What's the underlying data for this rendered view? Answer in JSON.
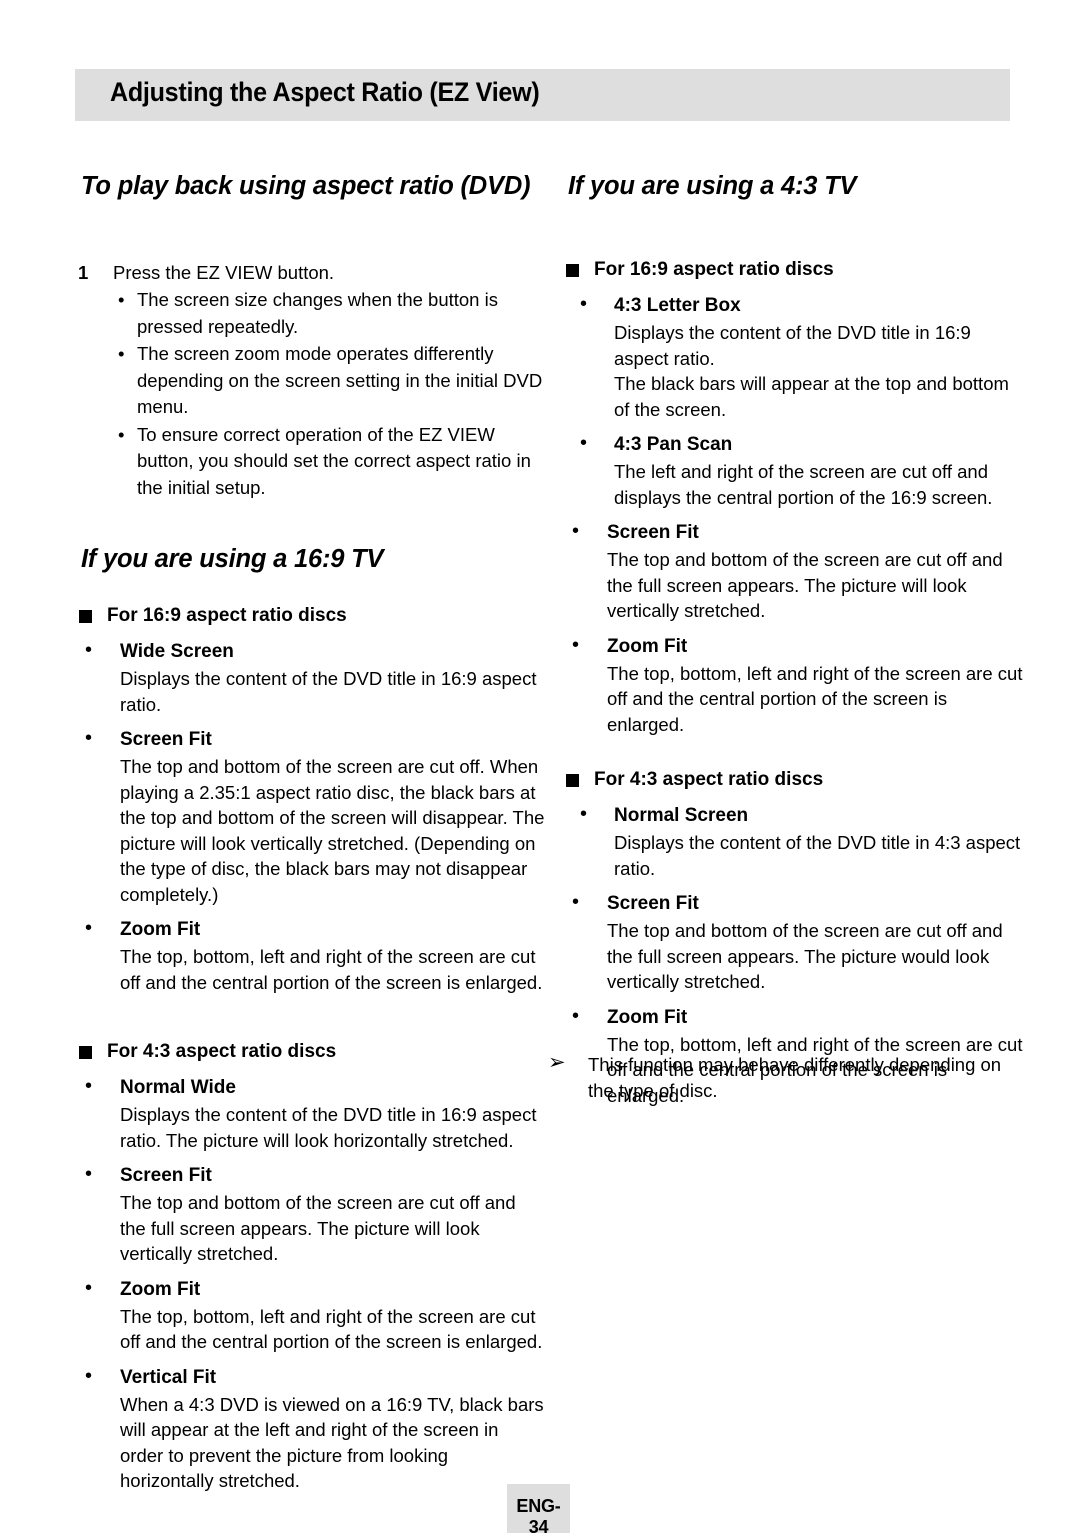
{
  "page": {
    "header_title": "Adjusting the Aspect Ratio (EZ View)",
    "footer_label": "ENG-34",
    "accent_gray": "#dedede"
  },
  "left_column": {
    "heading_1": "To play back using aspect ratio (DVD)",
    "step": {
      "number": "1",
      "text": "Press the EZ VIEW button.",
      "bullet_glyph": "•",
      "bullets": [
        "The screen size changes when the button is pressed repeatedly.",
        "The screen zoom mode operates differently depending on the screen setting in the initial DVD menu.",
        "To ensure correct operation of the EZ VIEW button, you should set the correct aspect ratio in the initial setup."
      ]
    },
    "heading_2": "If you are using a 16:9 TV",
    "group_16_9": {
      "title": "For 16:9 aspect ratio discs",
      "items": [
        {
          "name": "Wide Screen",
          "body": "Displays the content of the DVD title in 16:9 aspect ratio."
        },
        {
          "name": "Screen Fit",
          "body": "The top and bottom of the screen are cut off. When playing a 2.35:1 aspect ratio disc, the black bars at the top and bottom of the screen will disappear. The picture will look vertically stretched. (Depending on the type of disc, the black bars may not disappear completely.)"
        },
        {
          "name": "Zoom Fit",
          "body": "The top, bottom, left and right of the screen are cut off and the central portion of the screen is enlarged."
        }
      ]
    },
    "group_4_3": {
      "title": "For 4:3 aspect ratio discs",
      "items": [
        {
          "name": "Normal Wide",
          "body": "Displays the content of the DVD title in 16:9 aspect ratio. The picture will look horizontally stretched."
        },
        {
          "name": "Screen Fit",
          "body": "The top and bottom of the screen are cut off and the full screen appears. The picture will look vertically stretched."
        },
        {
          "name": "Zoom Fit",
          "body": "The top, bottom, left and right of the screen are cut off and the central portion of the screen is enlarged."
        },
        {
          "name": "Vertical Fit",
          "body": "When a 4:3 DVD is viewed on a 16:9 TV, black bars will appear at the left and right of the screen in order to prevent the picture from looking horizontally stretched."
        }
      ]
    }
  },
  "right_column": {
    "heading_1": "If you are using a 4:3 TV",
    "group_16_9": {
      "title": "For 16:9 aspect ratio discs",
      "items": [
        {
          "name": "4:3 Letter Box",
          "body": "Displays the content of the DVD title in 16:9 aspect ratio.",
          "body2": "The black bars will appear at the top and bottom of the screen."
        },
        {
          "name": "4:3 Pan Scan",
          "body": "The left and right of the screen are cut off and displays the central portion of the 16:9 screen."
        },
        {
          "name": "Screen Fit",
          "body": "The top and bottom of the screen are cut off and the full screen appears. The picture will look vertically stretched."
        },
        {
          "name": "Zoom Fit",
          "body": "The top, bottom, left and right of the screen are cut off and the central portion of the screen is enlarged."
        }
      ]
    },
    "group_4_3": {
      "title": "For 4:3 aspect ratio discs",
      "items": [
        {
          "name": "Normal Screen",
          "body": "Displays the content of the DVD title in 4:3 aspect ratio."
        },
        {
          "name": "Screen Fit",
          "body": "The top and bottom of the screen are cut off and the full screen appears. The picture would look vertically stretched."
        },
        {
          "name": "Zoom Fit",
          "body": "The top, bottom, left and right of the screen are cut off and the central portion of the screen is enlarged."
        }
      ]
    },
    "note": {
      "arrow_glyph": "➢",
      "text": "This function may behave differently depending on the type of disc."
    }
  }
}
